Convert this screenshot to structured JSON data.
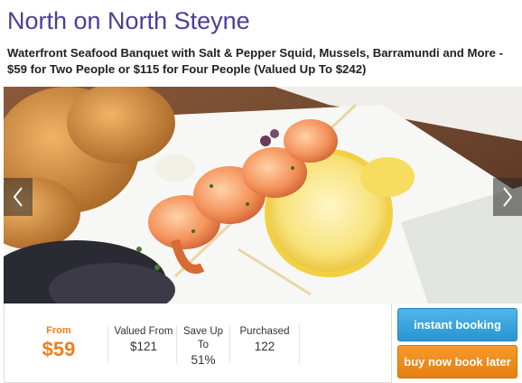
{
  "deal": {
    "merchant": "North on North Steyne",
    "headline": "Waterfront Seafood Banquet with Salt & Pepper Squid, Mussels, Barramundi and More - $59 for Two People or $115 for Four People (Valued Up To $242)"
  },
  "gallery": {
    "image_description": "grilled prawn skewer with lemon",
    "prev_icon": "chevron-left-icon",
    "next_icon": "chevron-right-icon"
  },
  "pricing": {
    "from_label": "From",
    "price": "$59",
    "valued_from_label": "Valued From",
    "valued_from_value": "$121",
    "save_label_line1": "Save Up",
    "save_label_line2": "To",
    "save_value": "51%",
    "purchased_label": "Purchased",
    "purchased_value": "122"
  },
  "actions": {
    "instant_booking_label": "instant booking",
    "buy_now_label": "buy now book later"
  },
  "colors": {
    "title": "#4a3f9a",
    "price": "#f07d1e",
    "instant_button": "#2b9ad5",
    "buy_button": "#ef8c1e"
  }
}
